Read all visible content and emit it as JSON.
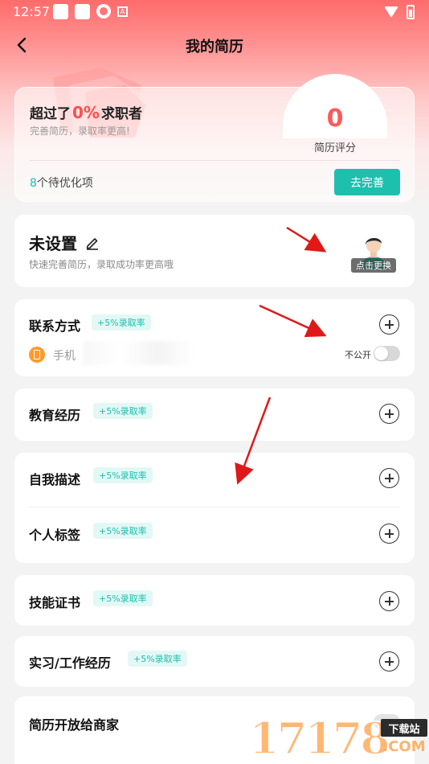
{
  "status_bar": {
    "time": "12:57"
  },
  "nav": {
    "title": "我的简历"
  },
  "score_card": {
    "exceed_prefix": "超过了",
    "exceed_percent": "0%",
    "exceed_suffix": "求职者",
    "subtitle": "完善简历，录取率更高!",
    "score": "0",
    "score_label": "简历评分",
    "pending_count": "8",
    "pending_text": "个待优化项",
    "improve_button": "去完善"
  },
  "profile": {
    "name": "未设置",
    "subtitle": "快速完善简历，录取成功率更高哦",
    "avatar_change": "点击更换"
  },
  "sections": {
    "contact": {
      "title": "联系方式",
      "badge": "+5%录取率",
      "phone_label": "手机",
      "private_label": "不公开",
      "private_enabled": false
    },
    "education": {
      "title": "教育经历",
      "badge": "+5%录取率"
    },
    "self_description": {
      "title": "自我描述",
      "badge": "+5%录取率"
    },
    "personal_tags": {
      "title": "个人标签",
      "badge": "+5%录取率"
    },
    "skills": {
      "title": "技能证书",
      "badge": "+5%录取率"
    },
    "work": {
      "title": "实习/工作经历",
      "badge": "+5%录取率"
    },
    "open_to_merchants": {
      "title": "简历开放给商家",
      "enabled": false
    }
  },
  "watermark": {
    "digits": "17178",
    "label": "下载站",
    "suffix": ".COM"
  },
  "colors": {
    "accent": "#1ec0ad",
    "highlight": "#ff4d4d",
    "header_gradient_top": "#ff6b6b",
    "annotation_arrow": "#e01818"
  }
}
